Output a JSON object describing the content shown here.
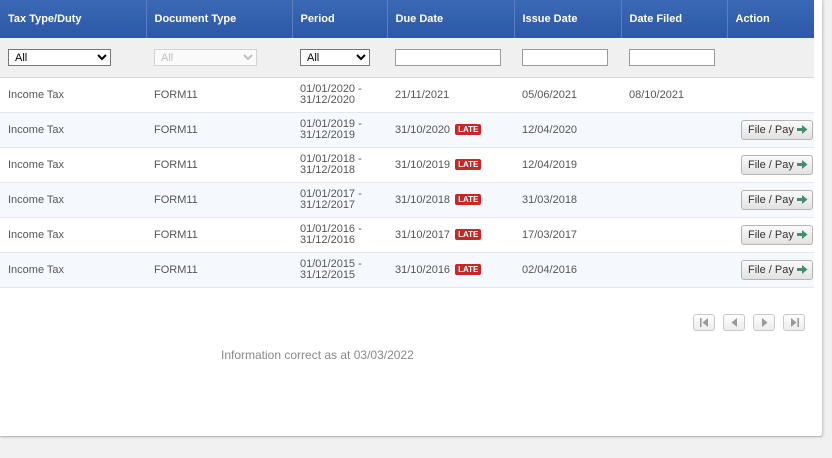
{
  "table": {
    "headers": [
      "Tax Type/Duty",
      "Document Type",
      "Period",
      "Due Date",
      "Issue Date",
      "Date Filed",
      "Action"
    ],
    "filters": {
      "tax_type": "All",
      "document_type": "All",
      "period": "All",
      "due_date": "",
      "issue_date": "",
      "date_filed": ""
    },
    "rows": [
      {
        "tax_type": "Income Tax",
        "document_type": "FORM11",
        "period_start": "01/01/2020 -",
        "period_end": "31/12/2020",
        "due_date": "21/11/2021",
        "late": "",
        "issue_date": "05/06/2021",
        "date_filed": "08/10/2021",
        "action": ""
      },
      {
        "tax_type": "Income Tax",
        "document_type": "FORM11",
        "period_start": "01/01/2019 -",
        "period_end": "31/12/2019",
        "due_date": "31/10/2020",
        "late": "LATE",
        "issue_date": "12/04/2020",
        "date_filed": "",
        "action": "File / Pay"
      },
      {
        "tax_type": "Income Tax",
        "document_type": "FORM11",
        "period_start": "01/01/2018 -",
        "period_end": "31/12/2018",
        "due_date": "31/10/2019",
        "late": "LATE",
        "issue_date": "12/04/2019",
        "date_filed": "",
        "action": "File / Pay"
      },
      {
        "tax_type": "Income Tax",
        "document_type": "FORM11",
        "period_start": "01/01/2017 -",
        "period_end": "31/12/2017",
        "due_date": "31/10/2018",
        "late": "LATE",
        "issue_date": "31/03/2018",
        "date_filed": "",
        "action": "File / Pay"
      },
      {
        "tax_type": "Income Tax",
        "document_type": "FORM11",
        "period_start": "01/01/2016 -",
        "period_end": "31/12/2016",
        "due_date": "31/10/2017",
        "late": "LATE",
        "issue_date": "17/03/2017",
        "date_filed": "",
        "action": "File / Pay"
      },
      {
        "tax_type": "Income Tax",
        "document_type": "FORM11",
        "period_start": "01/01/2015 -",
        "period_end": "31/12/2015",
        "due_date": "31/10/2016",
        "late": "LATE",
        "issue_date": "02/04/2016",
        "date_filed": "",
        "action": "File / Pay"
      }
    ]
  },
  "pagination": {
    "icons": [
      "first-page-icon",
      "previous-page-icon",
      "next-page-icon",
      "last-page-icon"
    ]
  },
  "footer": {
    "info": "Information correct as at 03/03/2022"
  },
  "colors": {
    "header": "#2f5ea9",
    "late_badge": "#c62828",
    "action_arrow": "#4a8a6e"
  }
}
